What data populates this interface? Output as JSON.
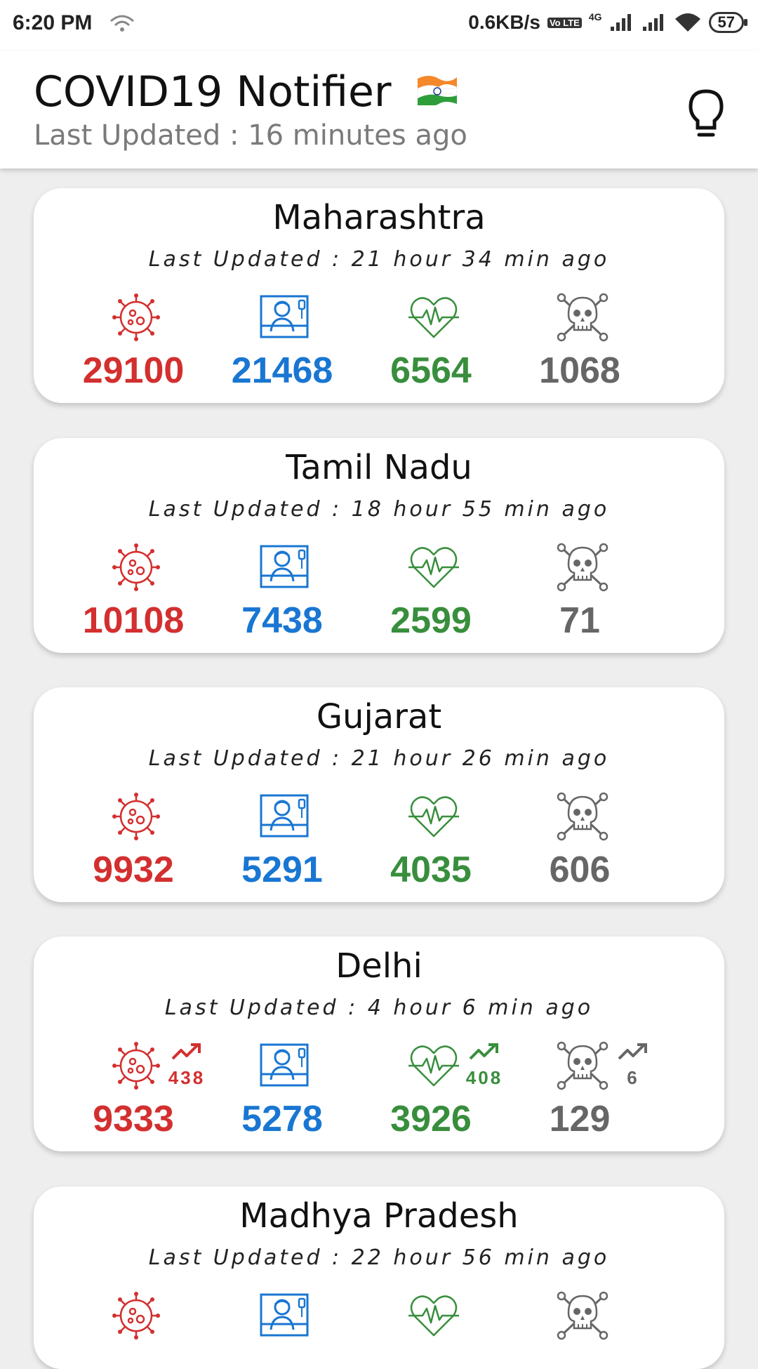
{
  "status_bar": {
    "time": "6:20 PM",
    "net_speed": "0.6KB/s",
    "volte": "Vo LTE",
    "network": "4G",
    "battery": "57"
  },
  "header": {
    "title": "COVID19 Notifier",
    "subtitle": "Last Updated : 16 minutes ago",
    "icons": [
      "india-flag-icon",
      "lightbulb-icon"
    ]
  },
  "states": [
    {
      "name": "Maharashtra",
      "updated": "Last Updated : 21 hour 34 min ago",
      "confirmed": "29100",
      "active": "21468",
      "recovered": "6564",
      "deaths": "1068"
    },
    {
      "name": "Tamil Nadu",
      "updated": "Last Updated : 18 hour 55 min ago",
      "confirmed": "10108",
      "active": "7438",
      "recovered": "2599",
      "deaths": "71"
    },
    {
      "name": "Gujarat",
      "updated": "Last Updated : 21 hour 26 min ago",
      "confirmed": "9932",
      "active": "5291",
      "recovered": "4035",
      "deaths": "606"
    },
    {
      "name": "Delhi",
      "updated": "Last Updated : 4 hour 6 min ago",
      "confirmed": "9333",
      "active": "5278",
      "recovered": "3926",
      "deaths": "129",
      "confirmed_delta": "438",
      "recovered_delta": "408",
      "deaths_delta": "6"
    },
    {
      "name": "Madhya Pradesh",
      "updated": "Last Updated : 22 hour 56 min ago"
    }
  ],
  "colors": {
    "confirmed": "#d32f2f",
    "active": "#1976d2",
    "recovered": "#388e3c",
    "deaths": "#666666"
  },
  "stat_icons": [
    "virus-icon",
    "patient-bed-icon",
    "heartbeat-icon",
    "skull-crossbones-icon"
  ]
}
